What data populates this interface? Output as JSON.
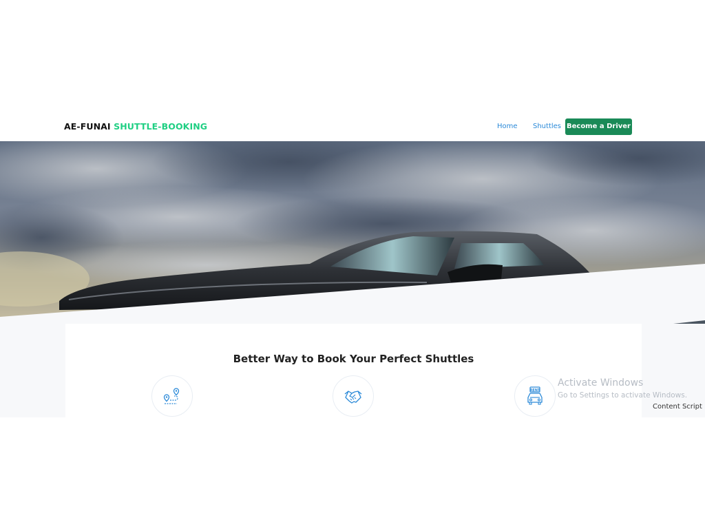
{
  "navbar": {
    "brand_primary": "AE-FUNAI",
    "brand_accent": "SHUTTLE-BOOKING",
    "links": [
      "Home",
      "Shuttles"
    ],
    "cta_label": "Become a Driver"
  },
  "hero": {
    "image": "dark sports car under cloudy sky"
  },
  "features": {
    "title": "Better Way to Book Your Perfect Shuttles",
    "icons": [
      "route-map-icon",
      "handshake-icon",
      "rent-car-icon"
    ]
  },
  "overlay": {
    "activate_title": "Activate Windows",
    "activate_subtitle": "Go to Settings to activate Windows.",
    "content_script": "Content Script"
  },
  "colors": {
    "accent": "#1fcf83",
    "cta": "#1a8a57",
    "link": "#2a89d8",
    "icon": "#2a89d8"
  }
}
